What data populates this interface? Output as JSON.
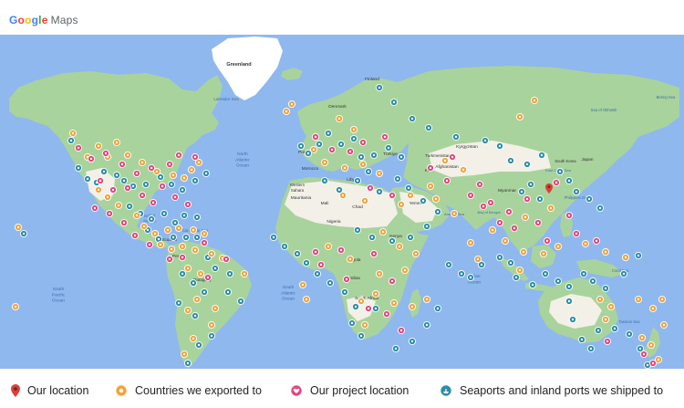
{
  "app": {
    "logo_letters": [
      "G",
      "o",
      "o",
      "g",
      "l",
      "e"
    ],
    "logo_colors": [
      "#4285f4",
      "#ea4335",
      "#fbbc05",
      "#4285f4",
      "#34a853",
      "#ea4335"
    ],
    "logo_word": "Maps"
  },
  "map": {
    "ocean_color": "#8fb8ee",
    "land_color": "#a9d39c",
    "desert_color": "#f3f0e8",
    "ice_color": "#ffffff",
    "labels": {
      "greenland": "Greenland",
      "labrador_sea": "Labrador Sea",
      "north_atlantic": [
        "North",
        "Atlantic",
        "Ocean"
      ],
      "south_atlantic": [
        "South",
        "Atlantic",
        "Ocean"
      ],
      "south_pacific": [
        "South",
        "Pacific",
        "Ocean"
      ],
      "indian_ocean": [
        "Indian",
        "Ocean"
      ],
      "gulf_mexico": [
        "Gulf of",
        "Mexico"
      ],
      "caribbean": "Caribbean Sea",
      "finland": "Finland",
      "denmark": "Denmark",
      "portugal": "Portugal",
      "morocco": "Morocco",
      "libya": "Libya",
      "western_sahara": [
        "Western",
        "Sahara"
      ],
      "mauritania": "Mauritania",
      "mali": "Mali",
      "chad": "Chad",
      "nigeria": "Nigeria",
      "angola": "Angola",
      "namibia": "Namibia",
      "south_africa": "South Africa",
      "kenya": "Kenya",
      "kyrgyzstan": "Kyrgyzstan",
      "iran": "Iran",
      "afghanistan": "Afghanistan",
      "turkmenistan": "Turkmenistan",
      "turkiye": "Türkiye",
      "yemen": "Yemen",
      "myanmar": "Myanmar",
      "japan": "Japan",
      "south_korea": "South Korea",
      "east_china_sea": "East China Sea",
      "philippine_sea": "Philippine Sea",
      "coral_sea": "Coral Sea",
      "tasman_sea": "Tasman Sea",
      "ecuador": "Ecuador",
      "peru": "Peru",
      "paraguay": "Paraguay",
      "bay_of_bengal": "Bay of Bengal",
      "arabian_sea": "Arabian Sea",
      "okhotsk": "Sea of Okhotsk",
      "bering": "Bering Sea"
    },
    "markers": {
      "our_location": [
        [
          602,
          171
        ]
      ],
      "exported": [
        [
          20,
          211
        ],
        [
          17,
          298
        ],
        [
          80,
          108
        ],
        [
          96,
          134
        ],
        [
          108,
          122
        ],
        [
          118,
          134
        ],
        [
          128,
          118
        ],
        [
          140,
          132
        ],
        [
          156,
          140
        ],
        [
          172,
          150
        ],
        [
          190,
          154
        ],
        [
          210,
          148
        ],
        [
          218,
          140
        ],
        [
          202,
          157
        ],
        [
          108,
          170
        ],
        [
          118,
          178
        ],
        [
          130,
          187
        ],
        [
          150,
          198
        ],
        [
          158,
          210
        ],
        [
          170,
          218
        ],
        [
          184,
          214
        ],
        [
          196,
          212
        ],
        [
          212,
          214
        ],
        [
          224,
          218
        ],
        [
          176,
          230
        ],
        [
          188,
          235
        ],
        [
          200,
          232
        ],
        [
          214,
          236
        ],
        [
          232,
          240
        ],
        [
          244,
          245
        ],
        [
          206,
          256
        ],
        [
          220,
          262
        ],
        [
          268,
          262
        ],
        [
          216,
          290
        ],
        [
          206,
          302
        ],
        [
          236,
          300
        ],
        [
          232,
          318
        ],
        [
          212,
          333
        ],
        [
          202,
          350
        ],
        [
          314,
          84
        ],
        [
          320,
          76
        ],
        [
          372,
          92
        ],
        [
          388,
          104
        ],
        [
          344,
          126
        ],
        [
          356,
          140
        ],
        [
          378,
          146
        ],
        [
          398,
          142
        ],
        [
          416,
          152
        ],
        [
          376,
          176
        ],
        [
          400,
          182
        ],
        [
          440,
          186
        ],
        [
          450,
          176
        ],
        [
          472,
          166
        ],
        [
          478,
          180
        ],
        [
          498,
          196
        ],
        [
          420,
          216
        ],
        [
          438,
          232
        ],
        [
          456,
          240
        ],
        [
          444,
          258
        ],
        [
          360,
          232
        ],
        [
          384,
          246
        ],
        [
          416,
          262
        ],
        [
          332,
          274
        ],
        [
          336,
          290
        ],
        [
          396,
          292
        ],
        [
          412,
          284
        ],
        [
          432,
          294
        ],
        [
          400,
          318
        ],
        [
          452,
          298
        ],
        [
          468,
          290
        ],
        [
          516,
          228
        ],
        [
          524,
          246
        ],
        [
          540,
          214
        ],
        [
          554,
          226
        ],
        [
          574,
          238
        ],
        [
          596,
          240
        ],
        [
          570,
          258
        ],
        [
          612,
          232
        ],
        [
          642,
          229
        ],
        [
          664,
          238
        ],
        [
          686,
          244
        ],
        [
          576,
          200
        ],
        [
          604,
          190
        ],
        [
          658,
          290
        ],
        [
          670,
          298
        ],
        [
          664,
          312
        ],
        [
          700,
          290
        ],
        [
          726,
          290
        ],
        [
          716,
          300
        ],
        [
          728,
          318
        ],
        [
          704,
          332
        ],
        [
          714,
          340
        ],
        [
          722,
          356
        ],
        [
          570,
          90
        ],
        [
          586,
          72
        ],
        [
          488,
          138
        ],
        [
          508,
          148
        ]
      ],
      "project": [
        [
          86,
          124
        ],
        [
          100,
          136
        ],
        [
          116,
          130
        ],
        [
          134,
          142
        ],
        [
          150,
          152
        ],
        [
          166,
          146
        ],
        [
          186,
          142
        ],
        [
          196,
          132
        ],
        [
          214,
          134
        ],
        [
          110,
          160
        ],
        [
          124,
          170
        ],
        [
          140,
          168
        ],
        [
          156,
          176
        ],
        [
          168,
          184
        ],
        [
          178,
          166
        ],
        [
          192,
          178
        ],
        [
          206,
          186
        ],
        [
          104,
          190
        ],
        [
          120,
          196
        ],
        [
          136,
          206
        ],
        [
          148,
          220
        ],
        [
          164,
          230
        ],
        [
          186,
          246
        ],
        [
          200,
          244
        ],
        [
          224,
          228
        ],
        [
          228,
          266
        ],
        [
          248,
          246
        ],
        [
          346,
          112
        ],
        [
          364,
          126
        ],
        [
          384,
          128
        ],
        [
          398,
          118
        ],
        [
          422,
          112
        ],
        [
          406,
          168
        ],
        [
          430,
          176
        ],
        [
          472,
          146
        ],
        [
          496,
          134
        ],
        [
          490,
          160
        ],
        [
          516,
          176
        ],
        [
          526,
          164
        ],
        [
          538,
          184
        ],
        [
          548,
          206
        ],
        [
          558,
          194
        ],
        [
          578,
          180
        ],
        [
          610,
          162
        ],
        [
          346,
          238
        ],
        [
          352,
          252
        ],
        [
          374,
          236
        ],
        [
          410,
          240
        ],
        [
          430,
          270
        ],
        [
          380,
          268
        ],
        [
          404,
          300
        ],
        [
          424,
          306
        ],
        [
          440,
          324
        ],
        [
          530,
          188
        ],
        [
          564,
          212
        ],
        [
          590,
          206
        ],
        [
          600,
          226
        ],
        [
          624,
          198
        ],
        [
          632,
          218
        ],
        [
          654,
          226
        ],
        [
          716,
          360
        ],
        [
          706,
          350
        ],
        [
          666,
          336
        ]
      ],
      "seaport": [
        [
          26,
          218
        ],
        [
          78,
          116
        ],
        [
          86,
          146
        ],
        [
          96,
          158
        ],
        [
          106,
          162
        ],
        [
          114,
          150
        ],
        [
          128,
          154
        ],
        [
          136,
          160
        ],
        [
          146,
          166
        ],
        [
          160,
          164
        ],
        [
          176,
          156
        ],
        [
          188,
          164
        ],
        [
          200,
          170
        ],
        [
          214,
          160
        ],
        [
          226,
          152
        ],
        [
          142,
          188
        ],
        [
          154,
          196
        ],
        [
          166,
          202
        ],
        [
          180,
          196
        ],
        [
          192,
          206
        ],
        [
          202,
          198
        ],
        [
          216,
          200
        ],
        [
          162,
          214
        ],
        [
          174,
          224
        ],
        [
          190,
          222
        ],
        [
          204,
          222
        ],
        [
          216,
          222
        ],
        [
          228,
          244
        ],
        [
          236,
          256
        ],
        [
          252,
          262
        ],
        [
          200,
          262
        ],
        [
          212,
          272
        ],
        [
          224,
          282
        ],
        [
          250,
          282
        ],
        [
          264,
          292
        ],
        [
          196,
          294
        ],
        [
          214,
          308
        ],
        [
          232,
          330
        ],
        [
          218,
          340
        ],
        [
          206,
          360
        ],
        [
          330,
          122
        ],
        [
          338,
          130
        ],
        [
          350,
          120
        ],
        [
          360,
          108
        ],
        [
          374,
          120
        ],
        [
          388,
          114
        ],
        [
          396,
          134
        ],
        [
          410,
          132
        ],
        [
          426,
          124
        ],
        [
          440,
          134
        ],
        [
          356,
          160
        ],
        [
          372,
          170
        ],
        [
          392,
          160
        ],
        [
          404,
          150
        ],
        [
          416,
          172
        ],
        [
          436,
          158
        ],
        [
          448,
          168
        ],
        [
          464,
          182
        ],
        [
          480,
          194
        ],
        [
          468,
          210
        ],
        [
          450,
          222
        ],
        [
          430,
          226
        ],
        [
          408,
          222
        ],
        [
          392,
          214
        ],
        [
          300,
          222
        ],
        [
          312,
          232
        ],
        [
          326,
          240
        ],
        [
          336,
          250
        ],
        [
          348,
          262
        ],
        [
          362,
          272
        ],
        [
          378,
          282
        ],
        [
          390,
          298
        ],
        [
          412,
          300
        ],
        [
          386,
          316
        ],
        [
          396,
          330
        ],
        [
          434,
          344
        ],
        [
          452,
          336
        ],
        [
          468,
          318
        ],
        [
          480,
          300
        ],
        [
          492,
          252
        ],
        [
          506,
          262
        ],
        [
          516,
          266
        ],
        [
          528,
          252
        ],
        [
          548,
          244
        ],
        [
          560,
          250
        ],
        [
          566,
          266
        ],
        [
          584,
          274
        ],
        [
          598,
          262
        ],
        [
          612,
          270
        ],
        [
          624,
          276
        ],
        [
          640,
          262
        ],
        [
          650,
          270
        ],
        [
          664,
          278
        ],
        [
          684,
          262
        ],
        [
          700,
          242
        ],
        [
          638,
          334
        ],
        [
          648,
          344
        ],
        [
          656,
          324
        ],
        [
          674,
          322
        ],
        [
          690,
          328
        ],
        [
          702,
          344
        ],
        [
          710,
          362
        ],
        [
          624,
          292
        ],
        [
          628,
          312
        ],
        [
          416,
          58
        ],
        [
          432,
          74
        ],
        [
          452,
          92
        ],
        [
          470,
          102
        ],
        [
          500,
          112
        ],
        [
          532,
          116
        ],
        [
          548,
          122
        ],
        [
          560,
          138
        ],
        [
          578,
          142
        ],
        [
          594,
          132
        ],
        [
          614,
          150
        ],
        [
          624,
          160
        ],
        [
          632,
          172
        ],
        [
          646,
          180
        ],
        [
          658,
          190
        ],
        [
          572,
          172
        ],
        [
          582,
          164
        ],
        [
          592,
          180
        ]
      ]
    }
  },
  "legend": {
    "our_location": "Our location",
    "exported": "Countries we exported to",
    "project": "Our project location",
    "seaport": "Seaports and inland ports we shipped to",
    "red_color": "#d9413a",
    "orange_color": "#f2a33a",
    "pink_color": "#e5457e",
    "teal_color": "#2a8ea8"
  }
}
